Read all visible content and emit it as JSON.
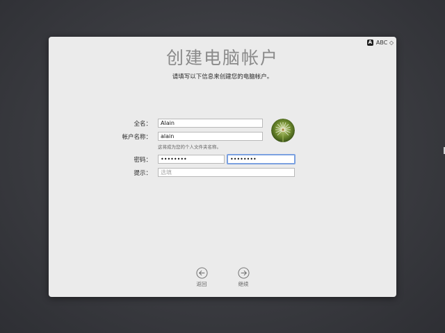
{
  "input_menu": {
    "badge": "A",
    "label": "ABC ◇"
  },
  "header": {
    "title": "创建电脑帐户",
    "subtitle": "请填写以下信息来创建您的电脑帐户。"
  },
  "form": {
    "full_name": {
      "label": "全名：",
      "value": "Alain"
    },
    "account_name": {
      "label": "帐户名称：",
      "value": "alain",
      "hint": "这将成为您的个人文件夹名称。"
    },
    "password": {
      "label": "密码：",
      "value": "••••••••",
      "verify_value": "••••••••"
    },
    "password_hint": {
      "label": "提示：",
      "placeholder": "选填"
    }
  },
  "nav": {
    "back_label": "返回",
    "continue_label": "继续"
  }
}
